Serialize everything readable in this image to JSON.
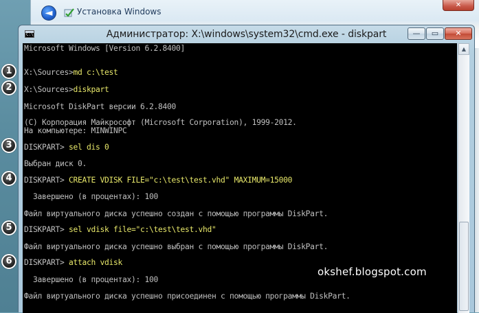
{
  "setup_window": {
    "title": "Установка Windows",
    "back_glyph": "◄",
    "close_glyph": "✕"
  },
  "cmd_window": {
    "title": "Администратор: X:\\windows\\system32\\cmd.exe - diskpart",
    "icon_glyph": "C:\\",
    "buttons": {
      "minimize": "—",
      "maximize": "▭",
      "close": "✕"
    }
  },
  "console": {
    "lines": [
      {
        "text": "Microsoft Windows [Version 6.2.8400]"
      },
      {
        "prompt": "X:\\Sources>",
        "command": "md c:\\test"
      },
      {
        "prompt": "X:\\Sources>",
        "command": "diskpart"
      },
      {
        "text": "Microsoft DiskPart версии 6.2.8400"
      },
      {
        "text": "(C) Корпорация Майкрософт (Microsoft Corporation), 1999-2012."
      },
      {
        "text": "На компьютере: MINWINPC"
      },
      {
        "prompt": "DISKPART> ",
        "command": "sel dis 0"
      },
      {
        "text": "Выбран диск 0."
      },
      {
        "prompt": "DISKPART> ",
        "command": "CREATE VDISK FILE=\"c:\\test\\test.vhd\" MAXIMUM=15000"
      },
      {
        "text": "  Завершено (в процентах): 100"
      },
      {
        "text": "Файл виртуального диска успешно создан с помощью программы DiskPart."
      },
      {
        "prompt": "DISKPART> ",
        "command": "sel vdisk file=\"c:\\test\\test.vhd\""
      },
      {
        "text": "Файл виртуального диска успешно выбран с помощью программы DiskPart."
      },
      {
        "prompt": "DISKPART> ",
        "command": "attach vdisk"
      },
      {
        "text": "  Завершено (в процентах): 100"
      },
      {
        "text": "Файл виртуального диска успешно присоединен с помощью программы DiskPart."
      }
    ]
  },
  "markers": [
    "1",
    "2",
    "3",
    "4",
    "5",
    "6"
  ],
  "watermark": "okshef.blogspot.com",
  "scrollbar": {
    "up_glyph": "▲"
  },
  "colors": {
    "console_bg": "#000000",
    "console_text": "#c0c0c0",
    "command_text": "#e8e86a",
    "marker_bg": "#2c2c2c"
  }
}
